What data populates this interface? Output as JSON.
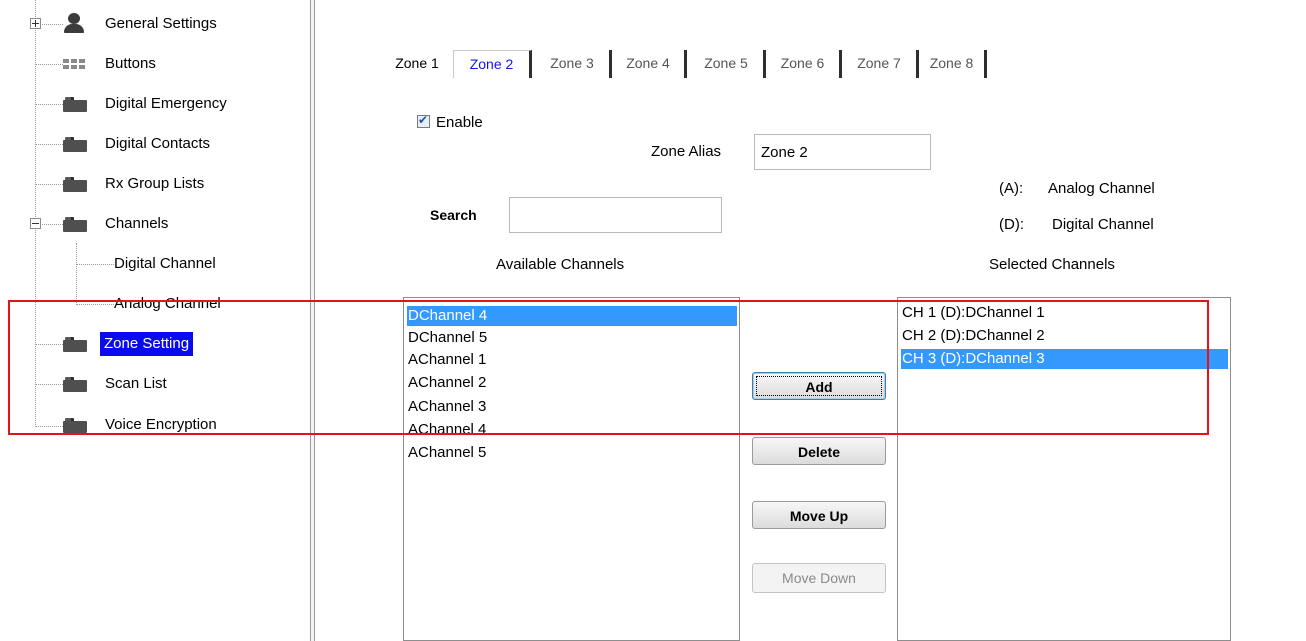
{
  "tree": {
    "items": [
      {
        "label": "General Settings",
        "icon": "person-icon"
      },
      {
        "label": "Buttons",
        "icon": "buttons-icon"
      },
      {
        "label": "Digital Emergency",
        "icon": "folder-icon"
      },
      {
        "label": "Digital Contacts",
        "icon": "folder-icon"
      },
      {
        "label": "Rx Group Lists",
        "icon": "folder-icon"
      },
      {
        "label": "Channels",
        "icon": "folder-icon"
      },
      {
        "label": "Digital Channel"
      },
      {
        "label": "Analog Channel"
      },
      {
        "label": "Zone Setting",
        "icon": "folder-icon",
        "selected": true
      },
      {
        "label": "Scan List",
        "icon": "folder-icon"
      },
      {
        "label": "Voice Encryption",
        "icon": "folder-icon"
      }
    ]
  },
  "tabs": [
    "Zone 1",
    "Zone 2",
    "Zone 3",
    "Zone 4",
    "Zone 5",
    "Zone 6",
    "Zone 7",
    "Zone 8"
  ],
  "active_tab": "Zone 2",
  "form": {
    "enable_label": "Enable",
    "enable_checked": true,
    "zone_alias_label": "Zone Alias",
    "zone_alias_value": "Zone 2",
    "legend_a_key": "(A):",
    "legend_a_text": "Analog Channel",
    "legend_d_key": "(D):",
    "legend_d_text": "Digital Channel",
    "search_label": "Search",
    "search_value": ""
  },
  "available": {
    "title": "Available Channels",
    "items": [
      "DChannel 4",
      "DChannel 5",
      "AChannel 1",
      "AChannel 2",
      "AChannel 3",
      "AChannel 4",
      "AChannel 5"
    ],
    "selected_index": 0
  },
  "selected": {
    "title": "Selected Channels",
    "items": [
      "CH 1 (D):DChannel 1",
      "CH 2 (D):DChannel 2",
      "CH 3 (D):DChannel 3"
    ],
    "selected_index": 2
  },
  "buttons": {
    "add": "Add",
    "delete": "Delete",
    "move_up": "Move Up",
    "move_down": "Move Down"
  },
  "colors": {
    "tree_selection": "#0a0af0",
    "list_selection": "#3399ff",
    "active_tab_text": "#1414e6",
    "highlight_box": "#e8101a"
  }
}
